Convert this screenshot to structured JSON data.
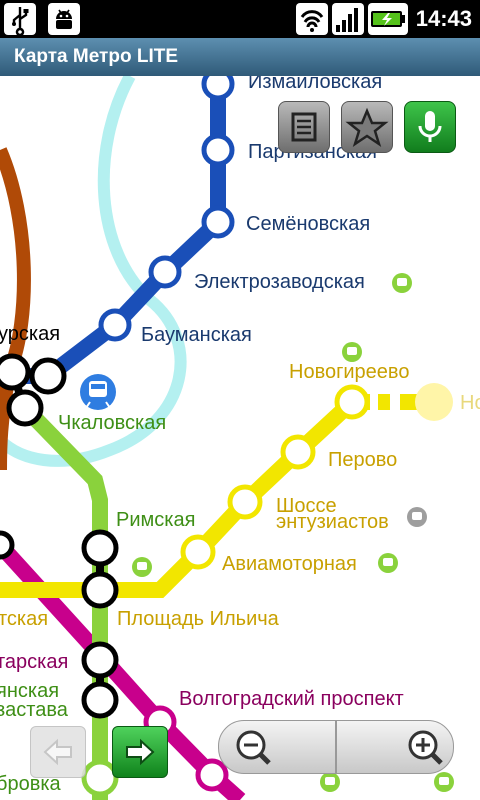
{
  "status_bar": {
    "time": "14:43",
    "icons": [
      "usb-icon",
      "android-debug-icon",
      "wifi-icon",
      "signal-icon",
      "battery-charging-icon"
    ]
  },
  "app": {
    "title": "Карта Метро LITE"
  },
  "toolbar": {
    "icons": [
      "list-icon",
      "star-icon",
      "microphone-icon"
    ]
  },
  "map": {
    "stations": {
      "izmaylovskaya": "Измайловская",
      "partizanskaya": "Партизанская",
      "semyonovskaya": "Семёновская",
      "elektrozavodskaya": "Электрозаводская",
      "baumanskaya": "Бауманская",
      "kurskaya_partial": "урская",
      "chkalovskaya": "Чкаловская",
      "novogireevo": "Новогиреево",
      "perovo": "Перово",
      "shosse_line1": "Шоссе",
      "shosse_line2": "энтузиастов",
      "aviamotornaya": "Авиамоторная",
      "rimskaya": "Римская",
      "ploshchad_ilyicha": "Площадь Ильича",
      "ktskaya_partial": "тская",
      "tarskaya_partial": "тарская",
      "yanskaya_line1": "янская",
      "yanskaya_line2": "застава",
      "volgogradsky": "Волгоградский проспект",
      "dubrovka_partial": "бровка",
      "novo_partial": "Но"
    },
    "line_colors": {
      "arbatsko_pokrovskaya": "#1a4fb8",
      "kalininskaya": "#f2e600",
      "lyublinskaya": "#8ad23c",
      "tagansko_krasnopresnenskaya": "#c8008c",
      "koltsevaya": "#b04a07",
      "planned_line": "#b4f0f0"
    }
  },
  "navigation": {
    "icons": [
      "back-arrow-icon",
      "forward-arrow-icon",
      "zoom-out-icon",
      "zoom-in-icon"
    ]
  }
}
